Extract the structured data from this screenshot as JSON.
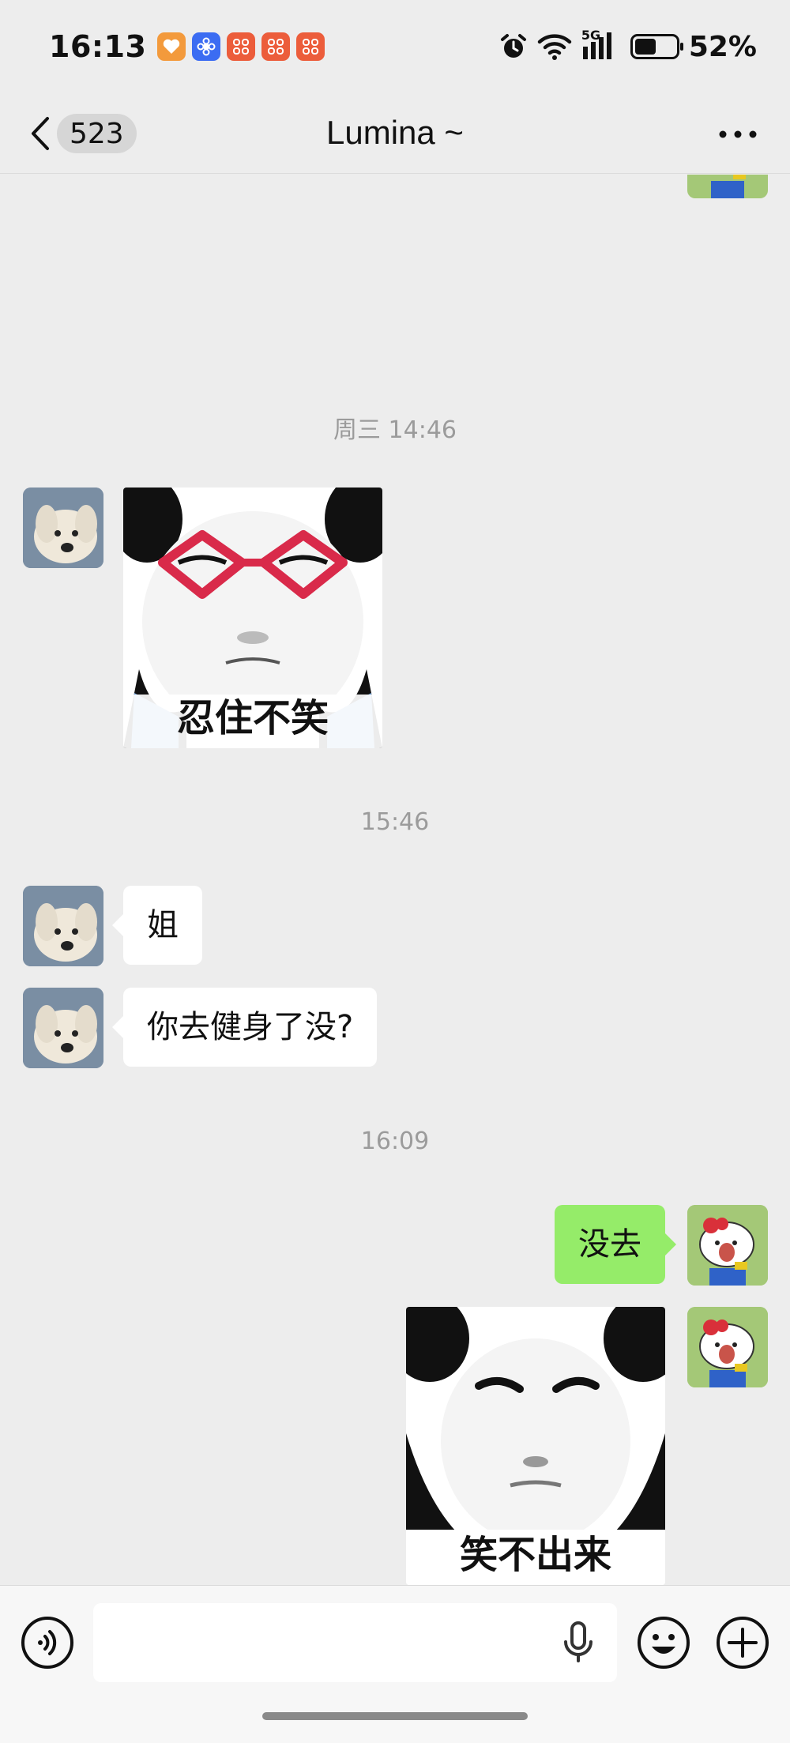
{
  "status_bar": {
    "time": "16:13",
    "battery_percent": "52%",
    "battery_level": 0.52,
    "network": "5G",
    "app_icons": [
      "heart-app-icon",
      "flower-app-icon",
      "grid-app-icon",
      "grid-app-icon",
      "grid-app-icon"
    ],
    "icons": [
      "alarm-icon",
      "wifi-icon",
      "signal-icon",
      "battery-icon"
    ]
  },
  "nav": {
    "unread_count": "523",
    "title": "Lumina ~"
  },
  "messages": [
    {
      "kind": "timestamp",
      "text": "周三 14:46"
    },
    {
      "kind": "sticker",
      "side": "left",
      "caption": "忍住不笑"
    },
    {
      "kind": "timestamp",
      "text": "15:46"
    },
    {
      "kind": "text",
      "side": "left",
      "text": "姐"
    },
    {
      "kind": "text",
      "side": "left",
      "text": "你去健身了没?"
    },
    {
      "kind": "timestamp",
      "text": "16:09"
    },
    {
      "kind": "text",
      "side": "right",
      "text": "没去"
    },
    {
      "kind": "sticker",
      "side": "right",
      "caption": "笑不出来"
    }
  ],
  "input_bar": {
    "value": "",
    "icons": [
      "voice-icon",
      "microphone-icon",
      "emoji-icon",
      "add-icon"
    ]
  },
  "colors": {
    "background": "#ededed",
    "sent_bubble": "#95ec69",
    "received_bubble": "#ffffff",
    "timestamp": "#9b9b9b"
  }
}
